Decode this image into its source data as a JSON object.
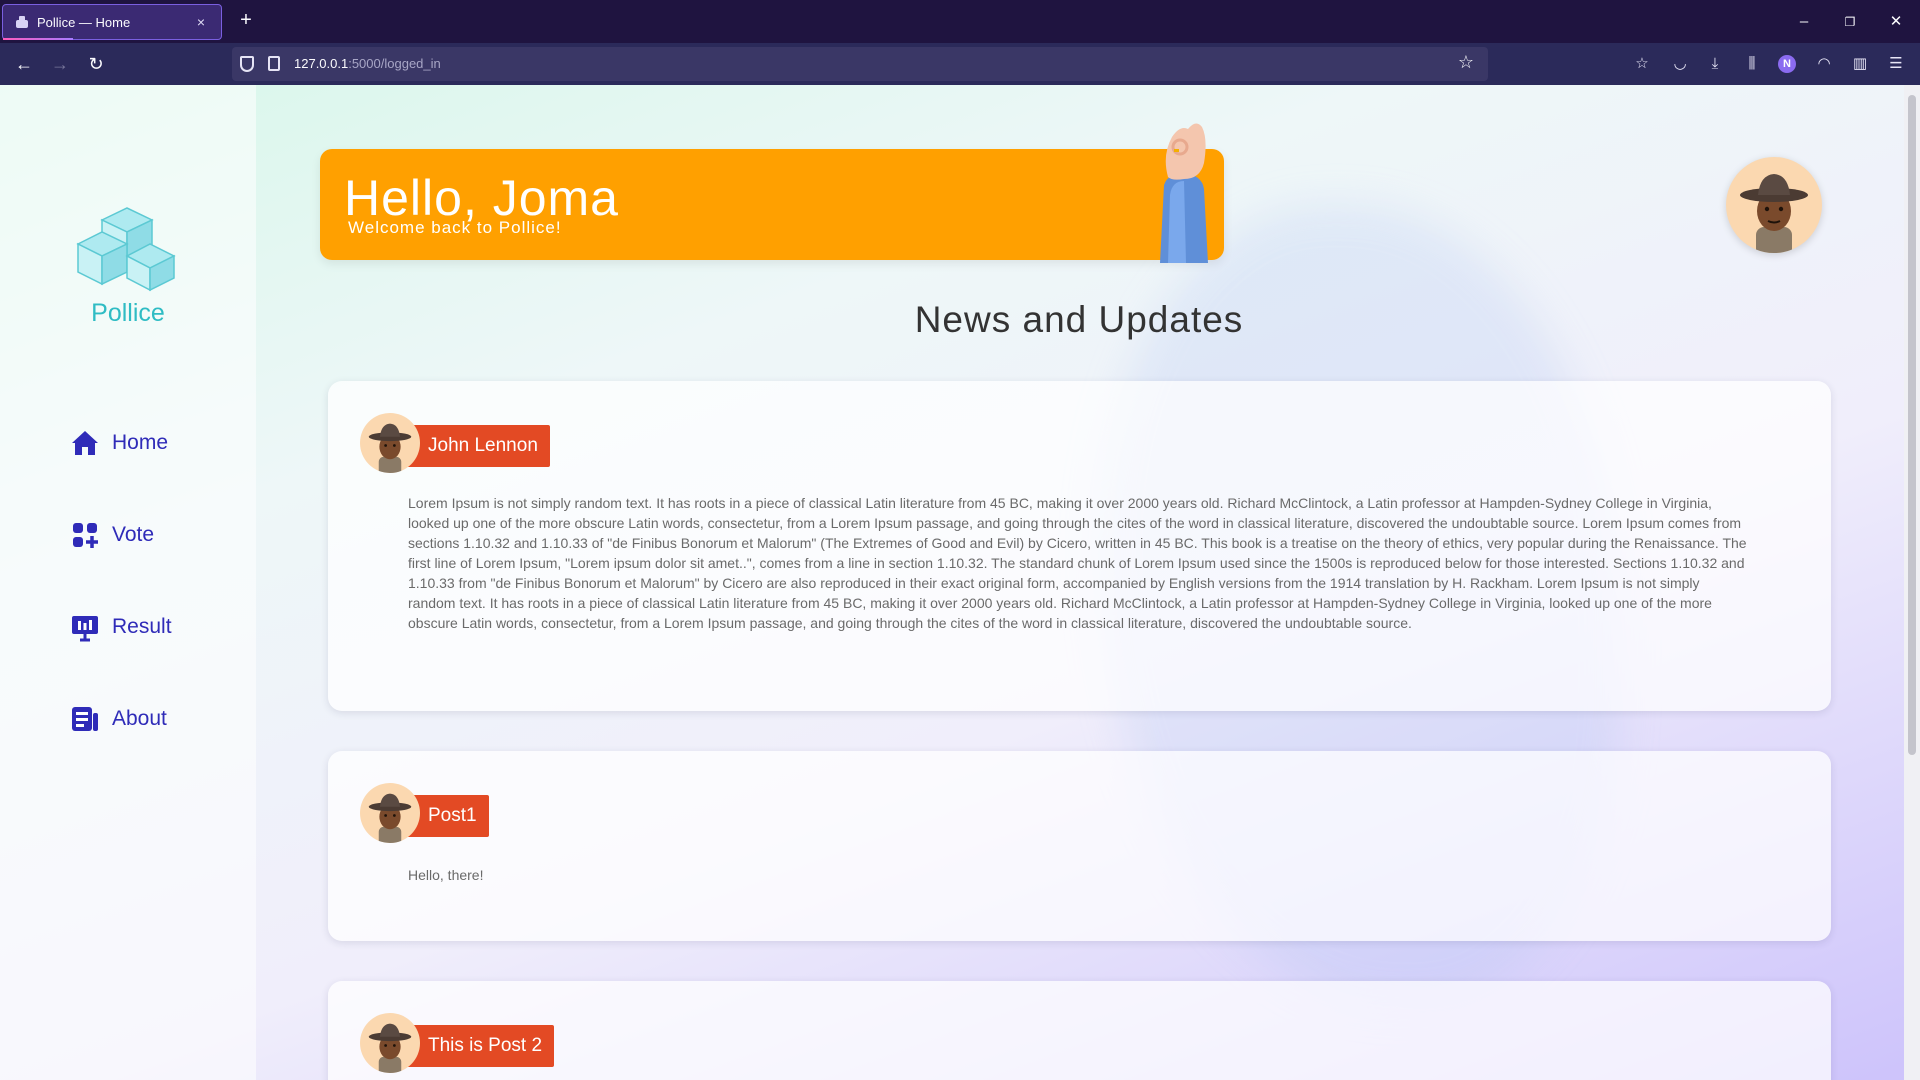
{
  "browser": {
    "tab_title": "Pollice — Home",
    "tab_close": "×",
    "new_tab": "+",
    "url_host": "127.0.0.1",
    "url_path": ":5000/logged_in",
    "minimize": "–",
    "restore": "❐",
    "close": "✕"
  },
  "sidebar": {
    "brand": "Pollice",
    "items": [
      {
        "label": "Home",
        "icon": "home-icon"
      },
      {
        "label": "Vote",
        "icon": "vote-icon"
      },
      {
        "label": "Result",
        "icon": "result-icon"
      },
      {
        "label": "About",
        "icon": "about-icon"
      }
    ]
  },
  "hero": {
    "title": "Hello, Joma",
    "subtitle": "Welcome back to Pollice!"
  },
  "main": {
    "section_title": "News and Updates",
    "posts": [
      {
        "author": "John Lennon",
        "body": "Lorem Ipsum is not simply random text. It has roots in a piece of classical Latin literature from 45 BC, making it over 2000 years old. Richard McClintock, a Latin professor at Hampden-Sydney College in Virginia, looked up one of the more obscure Latin words, consectetur, from a Lorem Ipsum passage, and going through the cites of the word in classical literature, discovered the undoubtable source. Lorem Ipsum comes from sections 1.10.32 and 1.10.33 of \"de Finibus Bonorum et Malorum\" (The Extremes of Good and Evil) by Cicero, written in 45 BC. This book is a treatise on the theory of ethics, very popular during the Renaissance. The first line of Lorem Ipsum, \"Lorem ipsum dolor sit amet..\", comes from a line in section 1.10.32. The standard chunk of Lorem Ipsum used since the 1500s is reproduced below for those interested. Sections 1.10.32 and 1.10.33 from \"de Finibus Bonorum et Malorum\" by Cicero are also reproduced in their exact original form, accompanied by English versions from the 1914 translation by H. Rackham. Lorem Ipsum is not simply random text. It has roots in a piece of classical Latin literature from 45 BC, making it over 2000 years old. Richard McClintock, a Latin professor at Hampden-Sydney College in Virginia, looked up one of the more obscure Latin words, consectetur, from a Lorem Ipsum passage, and going through the cites of the word in classical literature, discovered the undoubtable source."
      },
      {
        "author": "Post1",
        "body": "Hello, there!"
      },
      {
        "author": "This is Post 2",
        "body": ""
      }
    ]
  },
  "colors": {
    "accent": "#ffa000",
    "brand": "#2fbcc4",
    "nav": "#2f2bb8",
    "author_badge": "#e34a24"
  }
}
